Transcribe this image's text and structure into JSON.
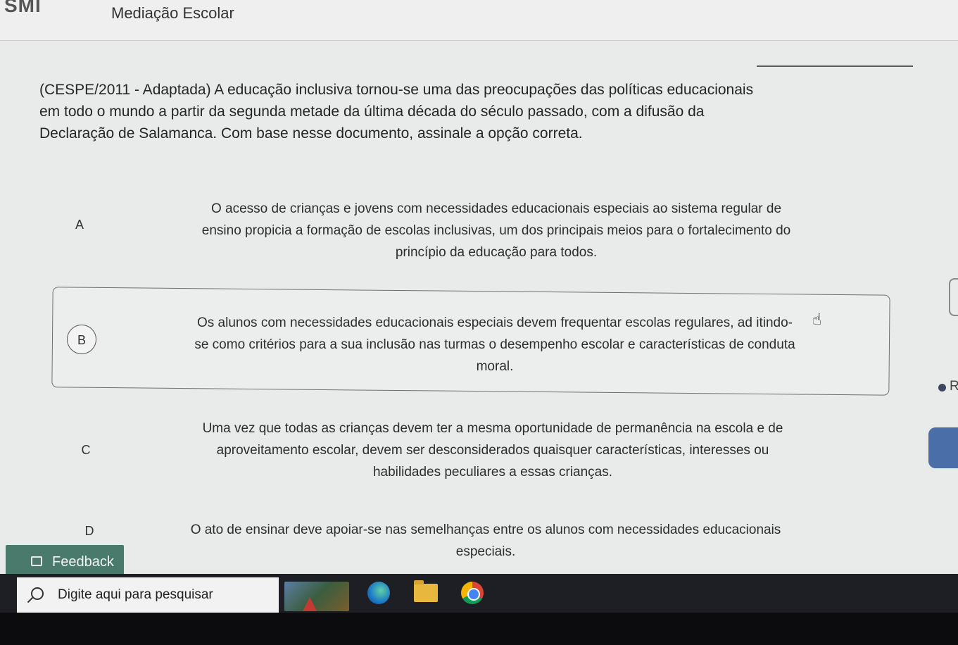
{
  "header": {
    "logo": "SMI",
    "course_title": "Mediação Escolar"
  },
  "question": {
    "lines": [
      "(CESPE/2011 - Adaptada) A educação inclusiva tornou-se uma das preocupações das políticas educacionais",
      "em todo o mundo a partir da segunda metade da última década do século passado, com a difusão da",
      "Declaração de Salamanca. Com base nesse documento, assinale a opção correta."
    ]
  },
  "options": [
    {
      "letter": "A",
      "lines": [
        "O acesso de crianças e jovens com necessidades educacionais especiais ao sistema regular de",
        "ensino propicia a formação de escolas inclusivas, um dos principais meios para o fortalecimento do",
        "princípio da educação para todos."
      ]
    },
    {
      "letter": "B",
      "selected": true,
      "lines": [
        "Os alunos com necessidades educacionais especiais devem frequentar escolas regulares, ad  itindo-",
        "se como critérios para a sua inclusão nas turmas o desempenho escolar e características de conduta",
        "moral."
      ]
    },
    {
      "letter": "C",
      "lines": [
        "Uma vez que todas as crianças devem ter a mesma oportunidade de permanência na escola e de",
        "aproveitamento escolar, devem ser desconsiderados quaisquer características, interesses ou",
        "habilidades peculiares a essas crianças."
      ]
    },
    {
      "letter": "D",
      "lines": [
        "O ato de ensinar deve apoiar-se nas semelhanças entre os alunos com necessidades educacionais",
        "especiais."
      ]
    }
  ],
  "side": {
    "letter": "R"
  },
  "feedback": {
    "label": "Feedback"
  },
  "taskbar": {
    "search_placeholder": "Digite aqui para pesquisar",
    "apps": [
      "video-thumbnail-icon",
      "edge-icon",
      "file-explorer-icon",
      "chrome-icon"
    ]
  },
  "colors": {
    "feedback_bg": "#4a7a6c",
    "side_tab": "#4a6ea8",
    "taskbar_bg": "#1d1f24"
  }
}
